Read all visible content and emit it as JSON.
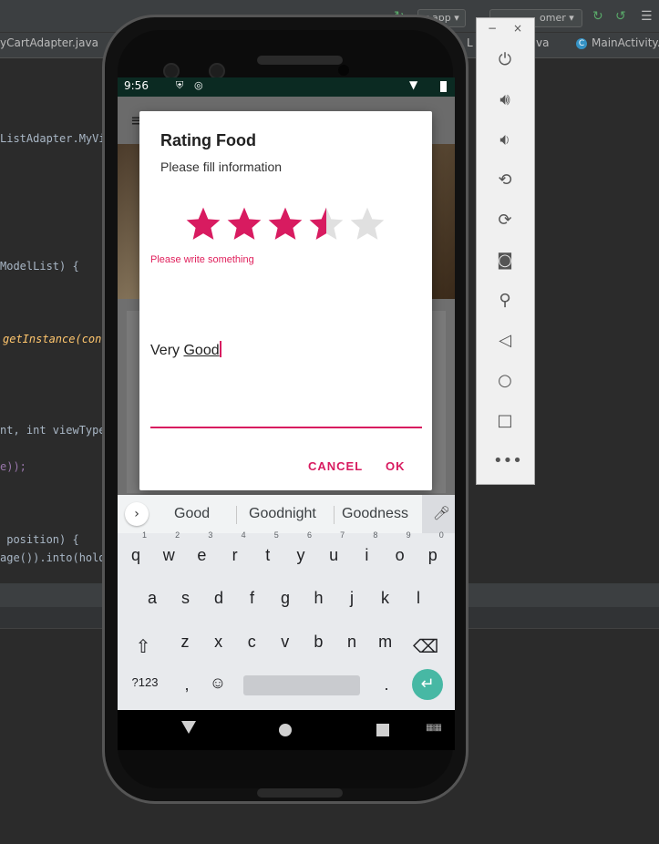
{
  "ide": {
    "tabs": [
      {
        "label": "yCartAdapter.java"
      },
      {
        "label": "L"
      },
      {
        "label": "va"
      },
      {
        "label": "MainActivity.j"
      }
    ],
    "run_config": "app",
    "device": "omer",
    "code_lines": [
      "ListAdapter.MyVie",
      "ModelList) {",
      "getInstance(cont",
      "nt, int viewType)",
      "e));",
      " position) {",
      "age()).into(holde"
    ]
  },
  "phone": {
    "status": {
      "time": "9:56"
    },
    "dialog": {
      "title": "Rating Food",
      "subtitle": "Please fill information",
      "rating": 3.5,
      "rating_max": 5,
      "hint": "Please write something",
      "input_value_plain": "Very ",
      "input_value_underlined": "Good",
      "cancel_label": "CANCEL",
      "ok_label": "OK"
    },
    "keyboard": {
      "suggestions": [
        "Good",
        "Goodnight",
        "Goodness"
      ],
      "row1": [
        "q",
        "w",
        "e",
        "r",
        "t",
        "y",
        "u",
        "i",
        "o",
        "p"
      ],
      "row1_nums": [
        "1",
        "2",
        "3",
        "4",
        "5",
        "6",
        "7",
        "8",
        "9",
        "0"
      ],
      "row2": [
        "a",
        "s",
        "d",
        "f",
        "g",
        "h",
        "j",
        "k",
        "l"
      ],
      "row3": [
        "z",
        "x",
        "c",
        "v",
        "b",
        "n",
        "m"
      ],
      "symbols_label": "?123",
      "comma": ",",
      "period": "."
    }
  },
  "colors": {
    "accent": "#d81b60",
    "star_empty": "#e0e0e0",
    "status_bar": "#0b2a22",
    "enter_key": "#47b8a4"
  }
}
